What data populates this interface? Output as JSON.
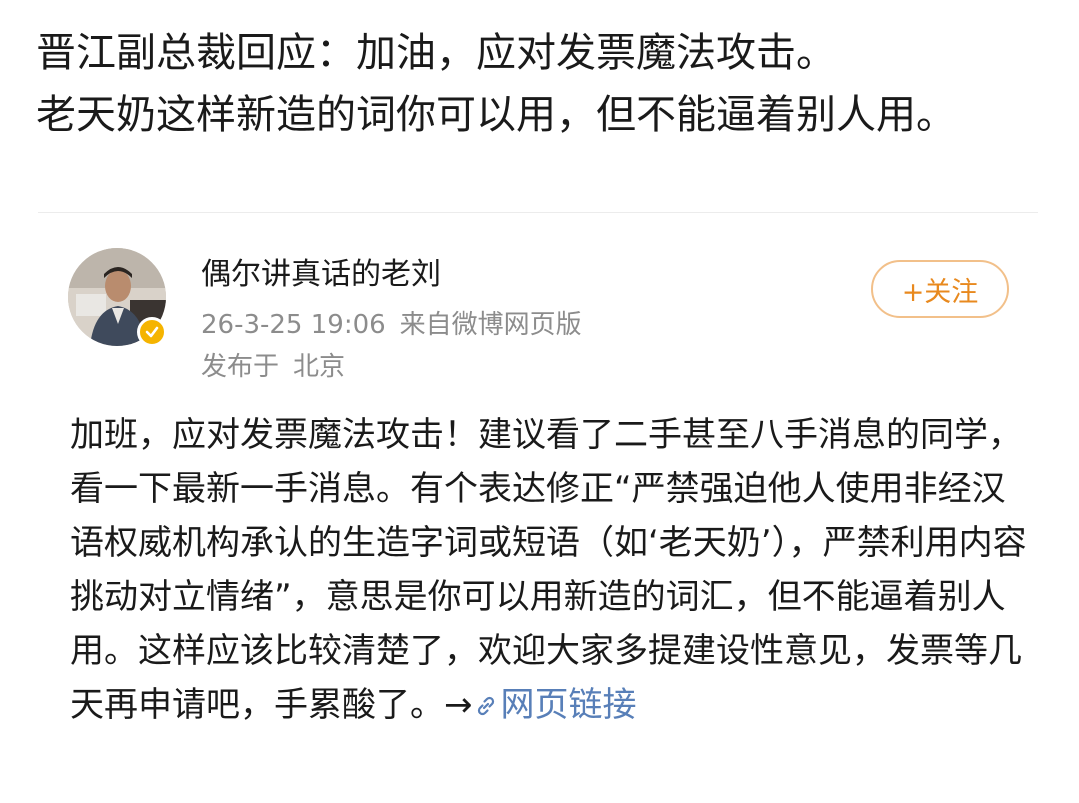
{
  "headline": {
    "line1": "晋江副总裁回应：加油，应对发票魔法攻击。",
    "line2": "老天奶这样新造的词你可以用，但不能逼着别人用。"
  },
  "post": {
    "author": "偶尔讲真话的老刘",
    "time": "26-3-25 19:06",
    "source": "来自微博网页版",
    "location_prefix": "发布于",
    "location": "北京",
    "follow_label": "+关注",
    "body": "加班，应对发票魔法攻击！建议看了二手甚至八手消息的同学，看一下最新一手消息。有个表达修正“严禁强迫他人使用非经汉语权威机构承认的生造字词或短语（如‘老天奶’），严禁利用内容挑动对立情绪”，意思是你可以用新造的词汇，但不能逼着别人用。这样应该比较清楚了，欢迎大家多提建设性意见，发票等几天再申请吧，手累酸了。",
    "arrow": "→",
    "link_label": "网页链接"
  },
  "colors": {
    "follow_accent": "#e8891e",
    "link": "#587fb8",
    "meta": "#8c8c8c",
    "verified_badge": "#f5b400"
  },
  "icons": {
    "verified": "verified-badge-icon",
    "link": "link-chain-icon"
  }
}
